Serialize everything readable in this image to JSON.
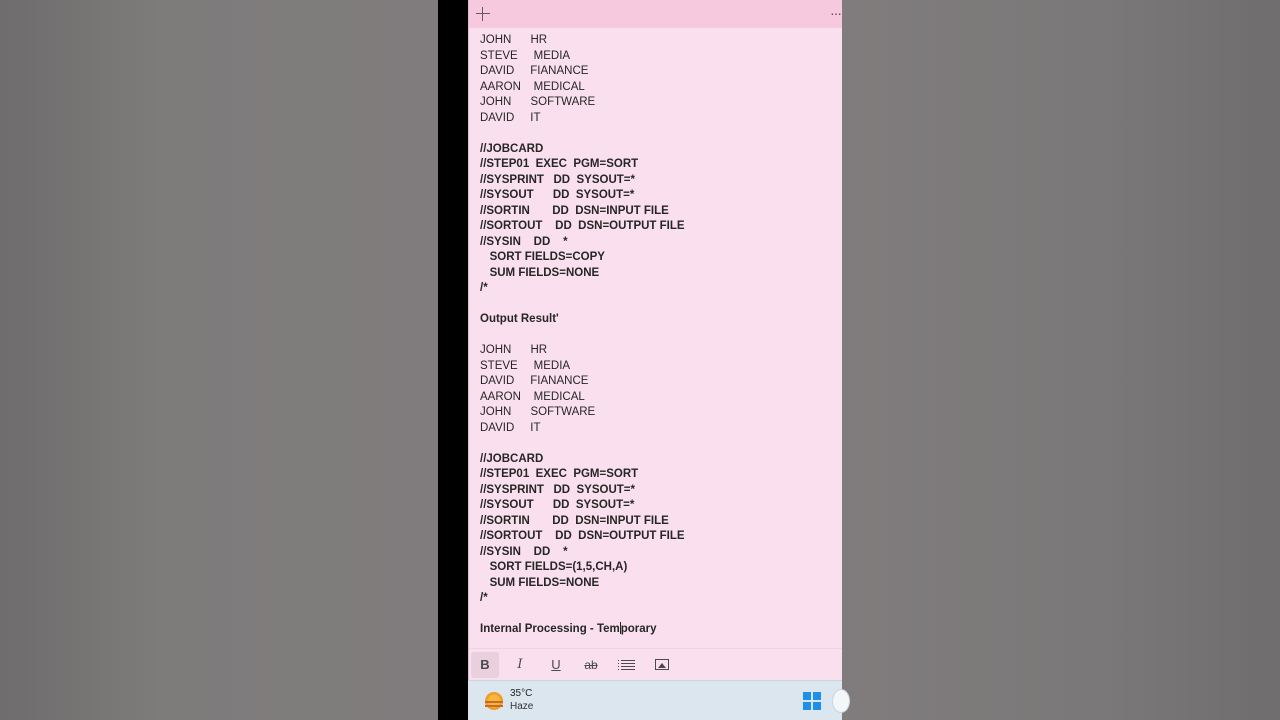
{
  "window": {
    "add_icon": "plus-icon",
    "more_icon": "more-horizontal-icon",
    "more_text": "···"
  },
  "note": {
    "lines": [
      {
        "text": "JOHN      HR",
        "bold": false
      },
      {
        "text": "STEVE     MEDIA",
        "bold": false
      },
      {
        "text": "DAVID     FIANANCE",
        "bold": false
      },
      {
        "text": "AARON    MEDICAL",
        "bold": false
      },
      {
        "text": "JOHN      SOFTWARE",
        "bold": false
      },
      {
        "text": "DAVID     IT",
        "bold": false
      },
      {
        "text": "",
        "bold": false
      },
      {
        "text": "//JOBCARD",
        "bold": true
      },
      {
        "text": "//STEP01  EXEC  PGM=SORT",
        "bold": true
      },
      {
        "text": "//SYSPRINT   DD  SYSOUT=*",
        "bold": true
      },
      {
        "text": "//SYSOUT      DD  SYSOUT=*",
        "bold": true
      },
      {
        "text": "//SORTIN       DD  DSN=INPUT FILE",
        "bold": true
      },
      {
        "text": "//SORTOUT    DD  DSN=OUTPUT FILE",
        "bold": true
      },
      {
        "text": "//SYSIN    DD    *",
        "bold": true
      },
      {
        "text": "   SORT FIELDS=COPY",
        "bold": true
      },
      {
        "text": "   SUM FIELDS=NONE",
        "bold": true
      },
      {
        "text": "/*",
        "bold": true
      },
      {
        "text": "",
        "bold": false
      },
      {
        "text": "Output Result'",
        "bold": true
      },
      {
        "text": "",
        "bold": false
      },
      {
        "text": "JOHN      HR",
        "bold": false
      },
      {
        "text": "STEVE     MEDIA",
        "bold": false
      },
      {
        "text": "DAVID     FIANANCE",
        "bold": false
      },
      {
        "text": "AARON    MEDICAL",
        "bold": false
      },
      {
        "text": "JOHN      SOFTWARE",
        "bold": false
      },
      {
        "text": "DAVID     IT",
        "bold": false
      },
      {
        "text": "",
        "bold": false
      },
      {
        "text": "//JOBCARD",
        "bold": true
      },
      {
        "text": "//STEP01  EXEC  PGM=SORT",
        "bold": true
      },
      {
        "text": "//SYSPRINT   DD  SYSOUT=*",
        "bold": true
      },
      {
        "text": "//SYSOUT      DD  SYSOUT=*",
        "bold": true
      },
      {
        "text": "//SORTIN       DD  DSN=INPUT FILE",
        "bold": true
      },
      {
        "text": "//SORTOUT    DD  DSN=OUTPUT FILE",
        "bold": true
      },
      {
        "text": "//SYSIN    DD    *",
        "bold": true
      },
      {
        "text": "   SORT FIELDS=(1,5,CH,A)",
        "bold": true
      },
      {
        "text": "   SUM FIELDS=NONE",
        "bold": true
      },
      {
        "text": "/*",
        "bold": true
      },
      {
        "text": "",
        "bold": false
      },
      {
        "text": "Internal Processing - Temporary",
        "bold": true,
        "caret_after": 25
      }
    ]
  },
  "toolbar": {
    "bold": "B",
    "italic": "I",
    "underline": "U",
    "strikethrough": "ab",
    "list_icon": "bulleted-list-icon",
    "image_icon": "image-icon"
  },
  "taskbar": {
    "weather_icon": "haze-sun-icon",
    "temperature": "35°C",
    "condition": "Haze",
    "start_icon": "windows-start-icon"
  },
  "colors": {
    "note_background": "#fae0ee",
    "titlebar": "#f7c9df",
    "taskbar": "#dbe6ef",
    "start_blue": "#1e90ea"
  }
}
